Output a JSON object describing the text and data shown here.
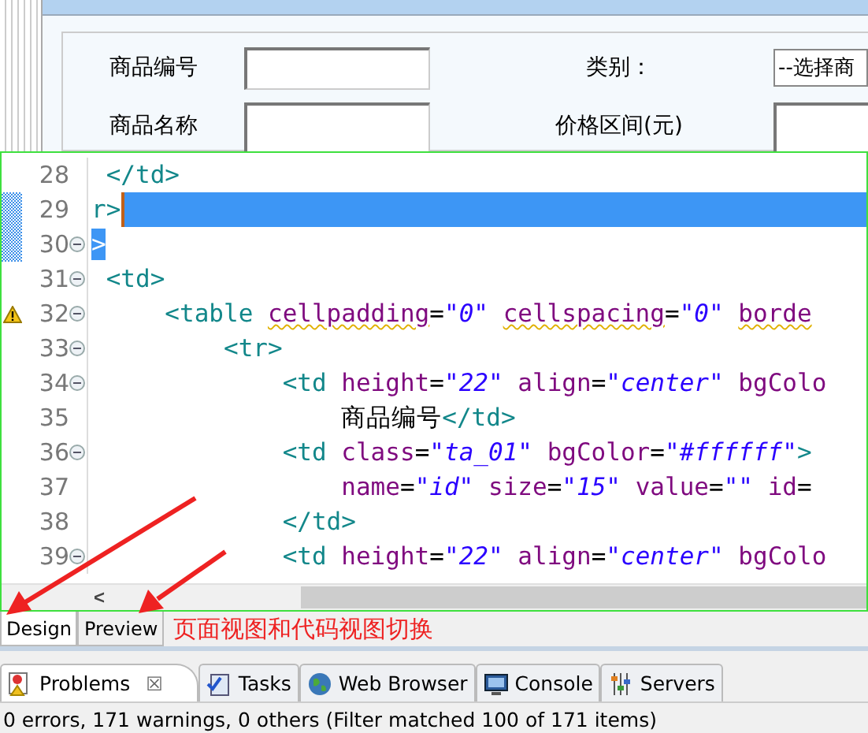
{
  "design_view": {
    "fields": [
      {
        "label": "商品编号",
        "kind": "input"
      },
      {
        "label": "类别：",
        "kind": "select",
        "value": "--选择商"
      }
    ],
    "fields_row_2": [
      {
        "label": "商品名称",
        "kind": "input"
      },
      {
        "label": "价格区间(元)",
        "kind": "input"
      }
    ]
  },
  "editor": {
    "lines": [
      {
        "number": "28",
        "fold": false,
        "warning": false,
        "changed": false,
        "selected": false,
        "tokens": [
          {
            "kind": "tag",
            "text": " </td>"
          }
        ]
      },
      {
        "number": "29",
        "fold": false,
        "warning": false,
        "changed": true,
        "selected": true,
        "tokens": [
          {
            "kind": "tag",
            "text": "r>"
          }
        ]
      },
      {
        "number": "30",
        "fold": true,
        "warning": false,
        "changed": true,
        "selected": false,
        "tokens": [
          {
            "kind": "tag",
            "text": ">",
            "match": true
          }
        ]
      },
      {
        "number": "31",
        "fold": true,
        "warning": false,
        "changed": false,
        "selected": false,
        "tokens": [
          {
            "kind": "tag",
            "text": " <td>"
          }
        ]
      },
      {
        "number": "32",
        "fold": true,
        "warning": true,
        "changed": false,
        "selected": false,
        "tokens": [
          {
            "kind": "tag",
            "text": "     <table "
          },
          {
            "kind": "attr",
            "text": "cellpadding",
            "squiggle": true
          },
          {
            "kind": "eq",
            "text": "="
          },
          {
            "kind": "value",
            "text": "\"0\" "
          },
          {
            "kind": "attr",
            "text": "cellspacing",
            "squiggle": true
          },
          {
            "kind": "eq",
            "text": "="
          },
          {
            "kind": "value",
            "text": "\"0\" "
          },
          {
            "kind": "attr",
            "text": "borde",
            "squiggle": true
          }
        ]
      },
      {
        "number": "33",
        "fold": true,
        "warning": false,
        "changed": false,
        "selected": false,
        "tokens": [
          {
            "kind": "tag",
            "text": "         <tr>"
          }
        ]
      },
      {
        "number": "34",
        "fold": true,
        "warning": false,
        "changed": false,
        "selected": false,
        "tokens": [
          {
            "kind": "tag",
            "text": "             <td "
          },
          {
            "kind": "attr",
            "text": "height"
          },
          {
            "kind": "eq",
            "text": "="
          },
          {
            "kind": "value",
            "text": "\"22\" "
          },
          {
            "kind": "attr",
            "text": "align"
          },
          {
            "kind": "eq",
            "text": "="
          },
          {
            "kind": "value",
            "text": "\"center\" "
          },
          {
            "kind": "attr",
            "text": "bgColo"
          }
        ]
      },
      {
        "number": "35",
        "fold": false,
        "warning": false,
        "changed": false,
        "selected": false,
        "tokens": [
          {
            "kind": "text",
            "text": "                 商品编号"
          },
          {
            "kind": "tag",
            "text": "</td>"
          }
        ]
      },
      {
        "number": "36",
        "fold": true,
        "warning": false,
        "changed": false,
        "selected": false,
        "tokens": [
          {
            "kind": "tag",
            "text": "             <td "
          },
          {
            "kind": "attr",
            "text": "class"
          },
          {
            "kind": "eq",
            "text": "="
          },
          {
            "kind": "value",
            "text": "\"ta_01\" "
          },
          {
            "kind": "attr",
            "text": "bgColor"
          },
          {
            "kind": "eq",
            "text": "="
          },
          {
            "kind": "value",
            "text": "\"#ffffff\""
          },
          {
            "kind": "tag",
            "text": ">"
          }
        ]
      },
      {
        "number": "37",
        "fold": false,
        "warning": false,
        "changed": false,
        "selected": false,
        "tokens": [
          {
            "kind": "attr",
            "text": "                 name"
          },
          {
            "kind": "eq",
            "text": "="
          },
          {
            "kind": "value",
            "text": "\"id\" "
          },
          {
            "kind": "attr",
            "text": "size"
          },
          {
            "kind": "eq",
            "text": "="
          },
          {
            "kind": "value",
            "text": "\"15\" "
          },
          {
            "kind": "attr",
            "text": "value"
          },
          {
            "kind": "eq",
            "text": "="
          },
          {
            "kind": "value",
            "text": "\"\" "
          },
          {
            "kind": "attr",
            "text": "id"
          },
          {
            "kind": "eq",
            "text": "="
          }
        ]
      },
      {
        "number": "38",
        "fold": false,
        "warning": false,
        "changed": false,
        "selected": false,
        "tokens": [
          {
            "kind": "tag",
            "text": "             </td>"
          }
        ]
      },
      {
        "number": "39",
        "fold": true,
        "warning": false,
        "changed": false,
        "selected": false,
        "tokens": [
          {
            "kind": "tag",
            "text": "             <td "
          },
          {
            "kind": "attr",
            "text": "height"
          },
          {
            "kind": "eq",
            "text": "="
          },
          {
            "kind": "value",
            "text": "\"22\" "
          },
          {
            "kind": "attr",
            "text": "align"
          },
          {
            "kind": "eq",
            "text": "="
          },
          {
            "kind": "value",
            "text": "\"center\" "
          },
          {
            "kind": "attr",
            "text": "bgColo"
          }
        ]
      }
    ],
    "scroll_left": "<"
  },
  "view_tabs": [
    {
      "label": "Design",
      "selected": true
    },
    {
      "label": "Preview",
      "selected": false
    }
  ],
  "annotation": "页面视图和代码视图切换",
  "panel_tabs": [
    {
      "label": "Problems",
      "selected": true,
      "close": "☒"
    },
    {
      "label": "Tasks",
      "selected": false
    },
    {
      "label": "Web Browser",
      "selected": false
    },
    {
      "label": "Console",
      "selected": false
    },
    {
      "label": "Servers",
      "selected": false
    }
  ],
  "status": "0 errors, 171 warnings, 0 others (Filter matched 100 of 171 items)"
}
